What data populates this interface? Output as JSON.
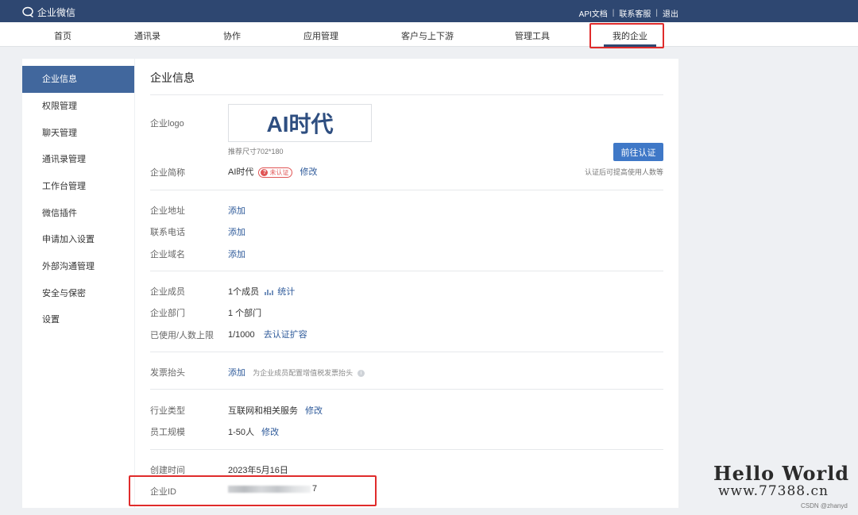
{
  "topbar": {
    "brand": "企业微信",
    "links": [
      "API文档",
      "联系客服",
      "退出"
    ],
    "separator": "|"
  },
  "nav": {
    "items": [
      "首页",
      "通讯录",
      "协作",
      "应用管理",
      "客户与上下游",
      "管理工具",
      "我的企业"
    ],
    "active_index": 6
  },
  "sidebar": {
    "items": [
      "企业信息",
      "权限管理",
      "聊天管理",
      "通讯录管理",
      "工作台管理",
      "微信插件",
      "申请加入设置",
      "外部沟通管理",
      "安全与保密",
      "设置"
    ],
    "active_index": 0
  },
  "page": {
    "title": "企业信息",
    "logo": {
      "label": "企业logo",
      "text": "AI时代",
      "hint": "推荐尺寸702*180"
    },
    "verify_button": "前往认证",
    "verify_hint": "认证后可提高使用人数等",
    "short_name": {
      "label": "企业简称",
      "value": "AI时代",
      "badge_icon": "?",
      "badge": "未认证",
      "action": "修改"
    },
    "address": {
      "label": "企业地址",
      "action": "添加"
    },
    "phone": {
      "label": "联系电话",
      "action": "添加"
    },
    "domain": {
      "label": "企业域名",
      "action": "添加"
    },
    "members": {
      "label": "企业成员",
      "value": "1个成员",
      "action": "统计"
    },
    "departments": {
      "label": "企业部门",
      "value": "1 个部门"
    },
    "usage": {
      "label": "已使用/人数上限",
      "value": "1/1000",
      "action": "去认证扩容"
    },
    "invoice": {
      "label": "发票抬头",
      "action": "添加",
      "hint": "为企业成员配置增值税发票抬头",
      "info_icon": "i"
    },
    "industry": {
      "label": "行业类型",
      "value": "互联网和相关服务",
      "action": "修改"
    },
    "scale": {
      "label": "员工规模",
      "value": "1-50人",
      "action": "修改"
    },
    "created": {
      "label": "创建时间",
      "value": "2023年5月16日"
    },
    "corp_id": {
      "label": "企业ID",
      "visible_tail": "7"
    }
  },
  "watermark": {
    "hello": "Hello World",
    "url": "www.77388.cn",
    "csdn": "CSDN @zhanyd"
  },
  "colors": {
    "topbar": "#2e4771",
    "sidebar_active": "#41679d",
    "link": "#2e5a9a",
    "button": "#3f78c7",
    "highlight_box": "#e02b2b",
    "unverified": "#e05555"
  }
}
